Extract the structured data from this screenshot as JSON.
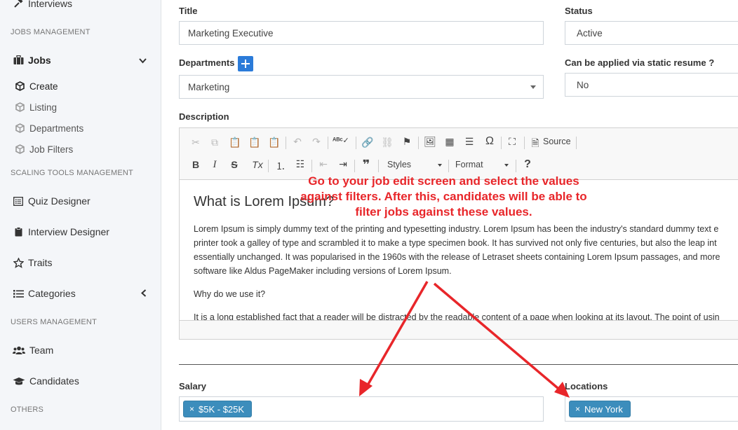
{
  "sidebar": {
    "interviews": "Interviews",
    "jobs_management": "JOBS MANAGEMENT",
    "jobs": "Jobs",
    "create": "Create",
    "listing": "Listing",
    "departments": "Departments",
    "job_filters": "Job Filters",
    "scaling_tools": "SCALING TOOLS MANAGEMENT",
    "quiz_designer": "Quiz Designer",
    "interview_designer": "Interview Designer",
    "traits": "Traits",
    "categories": "Categories",
    "users_management": "USERS MANAGEMENT",
    "team": "Team",
    "candidates": "Candidates",
    "others": "OTHERS"
  },
  "form": {
    "title_label": "Title",
    "title_value": "Marketing Executive",
    "status_label": "Status",
    "status_value": "Active",
    "departments_label": "Departments",
    "departments_value": "Marketing",
    "static_resume_label": "Can be applied via static resume ?",
    "static_resume_value": "No",
    "description_label": "Description",
    "salary_label": "Salary",
    "salary_tag": "$5K - $25K",
    "locations_label": "Locations",
    "locations_tag": "New York"
  },
  "editor": {
    "source_label": "Source",
    "styles_label": "Styles",
    "format_label": "Format",
    "heading": "What is Lorem Ipsum?",
    "para1_line1": "Lorem Ipsum is simply dummy text of the printing and typesetting industry. Lorem Ipsum has been the industry's standard dummy text e",
    "para1_line2": "printer took a galley of type and scrambled it to make a type specimen book. It has survived not only five centuries, but also the leap int",
    "para1_line3": "essentially unchanged. It was popularised in the 1960s with the release of Letraset sheets containing Lorem Ipsum passages, and more",
    "para1_line4": "software like Aldus PageMaker including versions of Lorem Ipsum.",
    "para2": "Why do we use it?",
    "para3": "It is a long established fact that a reader will be distracted by the readable content of a page when looking at its layout. The point of usin"
  },
  "annotation": {
    "line1": "Go to your job edit screen and select the values",
    "line2": "against filters. After this, candidates will be able to",
    "line3": "filter jobs against these values."
  },
  "colors": {
    "accent": "#3c8dbc",
    "plus_button": "#2b7bd9",
    "annotation": "#e8262a"
  }
}
